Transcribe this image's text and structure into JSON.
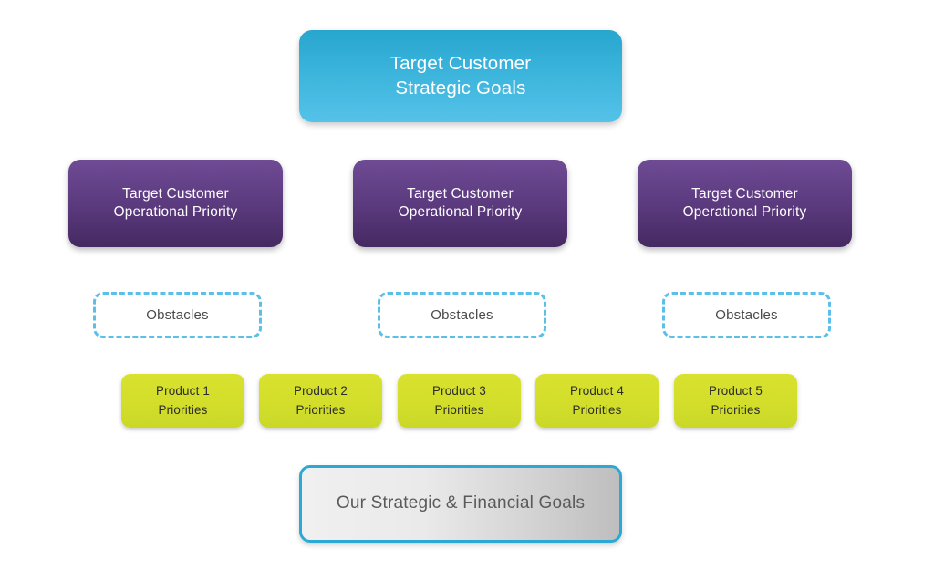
{
  "diagram": {
    "background_color": "#ffffff",
    "goal": {
      "lines": [
        "Target Customer",
        "Strategic Goals"
      ],
      "color_top": "#27a6ce",
      "color_bottom": "#55c2e8",
      "text_color": "#ffffff"
    },
    "priorities": [
      {
        "lines": [
          "Target Customer",
          "Operational Priority"
        ]
      },
      {
        "lines": [
          "Target Customer",
          "Operational Priority"
        ]
      },
      {
        "lines": [
          "Target Customer",
          "Operational Priority"
        ]
      }
    ],
    "priority_style": {
      "color_top": "#6e4b94",
      "color_bottom": "#452962",
      "text_color": "#ffffff"
    },
    "obstacles": [
      {
        "label": "Obstacles"
      },
      {
        "label": "Obstacles"
      },
      {
        "label": "Obstacles"
      }
    ],
    "obstacle_style": {
      "border_color": "#5bbfe8",
      "text_color": "#4a4a4a",
      "border_style": "dashed"
    },
    "products": [
      {
        "lines": [
          "Product 1",
          "Priorities"
        ]
      },
      {
        "lines": [
          "Product 2",
          "Priorities"
        ]
      },
      {
        "lines": [
          "Product 3",
          "Priorities"
        ]
      },
      {
        "lines": [
          "Product 4",
          "Priorities"
        ]
      },
      {
        "lines": [
          "Product 5",
          "Priorities"
        ]
      }
    ],
    "product_style": {
      "color": "#d3de2b",
      "text_color": "#2b2b2b"
    },
    "financial": {
      "label": "Our Strategic & Financial Goals",
      "border_color": "#2ba8d4",
      "fill_start": "#f0f0f0",
      "fill_end": "#bebebe",
      "text_color": "#5a5a5a"
    }
  }
}
